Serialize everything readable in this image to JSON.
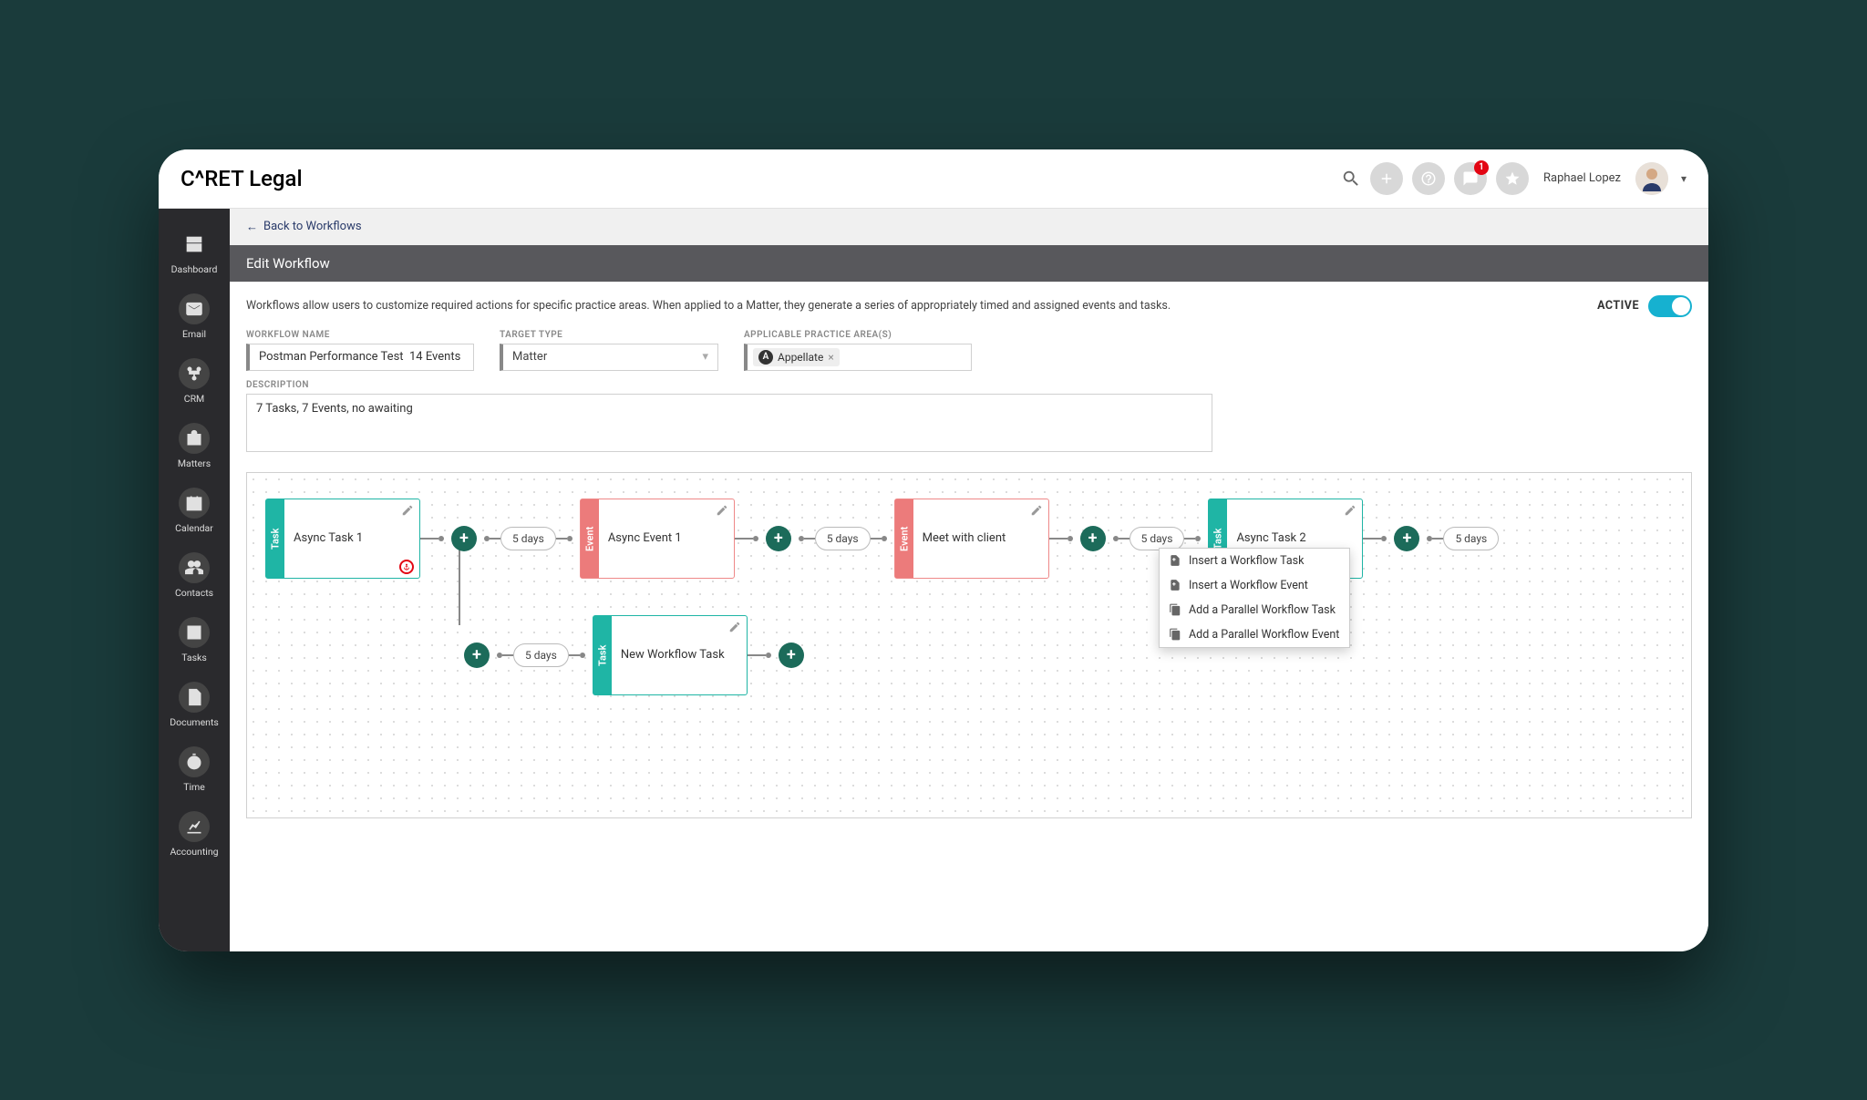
{
  "brand": {
    "prefix": "C",
    "caret": "^",
    "rest": "RET Legal"
  },
  "user": {
    "name": "Raphael Lopez"
  },
  "notifications": {
    "chat_count": "1"
  },
  "sidebar": {
    "items": [
      {
        "label": "Dashboard"
      },
      {
        "label": "Email"
      },
      {
        "label": "CRM"
      },
      {
        "label": "Matters"
      },
      {
        "label": "Calendar"
      },
      {
        "label": "Contacts"
      },
      {
        "label": "Tasks"
      },
      {
        "label": "Documents"
      },
      {
        "label": "Time"
      },
      {
        "label": "Accounting"
      }
    ]
  },
  "crumb": {
    "back": "Back to Workflows"
  },
  "header": {
    "title": "Edit Workflow"
  },
  "desc_text": "Workflows allow users to customize required actions for specific practice areas. When applied to a Matter, they generate a series of appropriately timed and assigned events and tasks.",
  "active_label": "ACTIVE",
  "form": {
    "name_label": "WORKFLOW NAME",
    "name_value": "Postman Performance Test  14 Events",
    "target_label": "TARGET TYPE",
    "target_value": "Matter",
    "area_label": "APPLICABLE PRACTICE AREA(S)",
    "area_tag_initial": "A",
    "area_tag_text": "Appellate",
    "desc_label": "DESCRIPTION",
    "desc_value": "7 Tasks, 7 Events, no awaiting"
  },
  "nodes": {
    "n1": {
      "type": "Task",
      "title": "Async Task 1"
    },
    "n2": {
      "type": "Event",
      "title": "Async Event 1"
    },
    "n3": {
      "type": "Event",
      "title": "Meet with client"
    },
    "n4": {
      "type": "Task",
      "title": "Async Task 2"
    },
    "n5": {
      "type": "Task",
      "title": "New Workflow Task"
    }
  },
  "delays": {
    "d1": "5 days",
    "d2": "5 days",
    "d3": "5 days",
    "d4": "5 days",
    "d5": "5 days"
  },
  "menu": {
    "i1": "Insert a Workflow Task",
    "i2": "Insert a Workflow Event",
    "i3": "Add a Parallel Workflow Task",
    "i4": "Add a Parallel Workflow Event"
  }
}
